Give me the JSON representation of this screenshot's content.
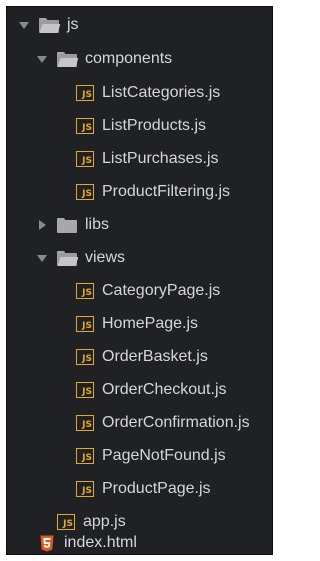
{
  "tree": {
    "root": {
      "label": "js"
    },
    "components": {
      "label": "components",
      "files": [
        "ListCategories.js",
        "ListProducts.js",
        "ListPurchases.js",
        "ProductFiltering.js"
      ]
    },
    "libs": {
      "label": "libs"
    },
    "views": {
      "label": "views",
      "files": [
        "CategoryPage.js",
        "HomePage.js",
        "OrderBasket.js",
        "OrderCheckout.js",
        "OrderConfirmation.js",
        "PageNotFound.js",
        "ProductPage.js"
      ]
    },
    "app": {
      "label": "app.js"
    },
    "index": {
      "label": "index.html"
    }
  },
  "icons": {
    "js_badge": "JS",
    "js_color": "#e2a92a",
    "html5_color": "#e4571f"
  }
}
